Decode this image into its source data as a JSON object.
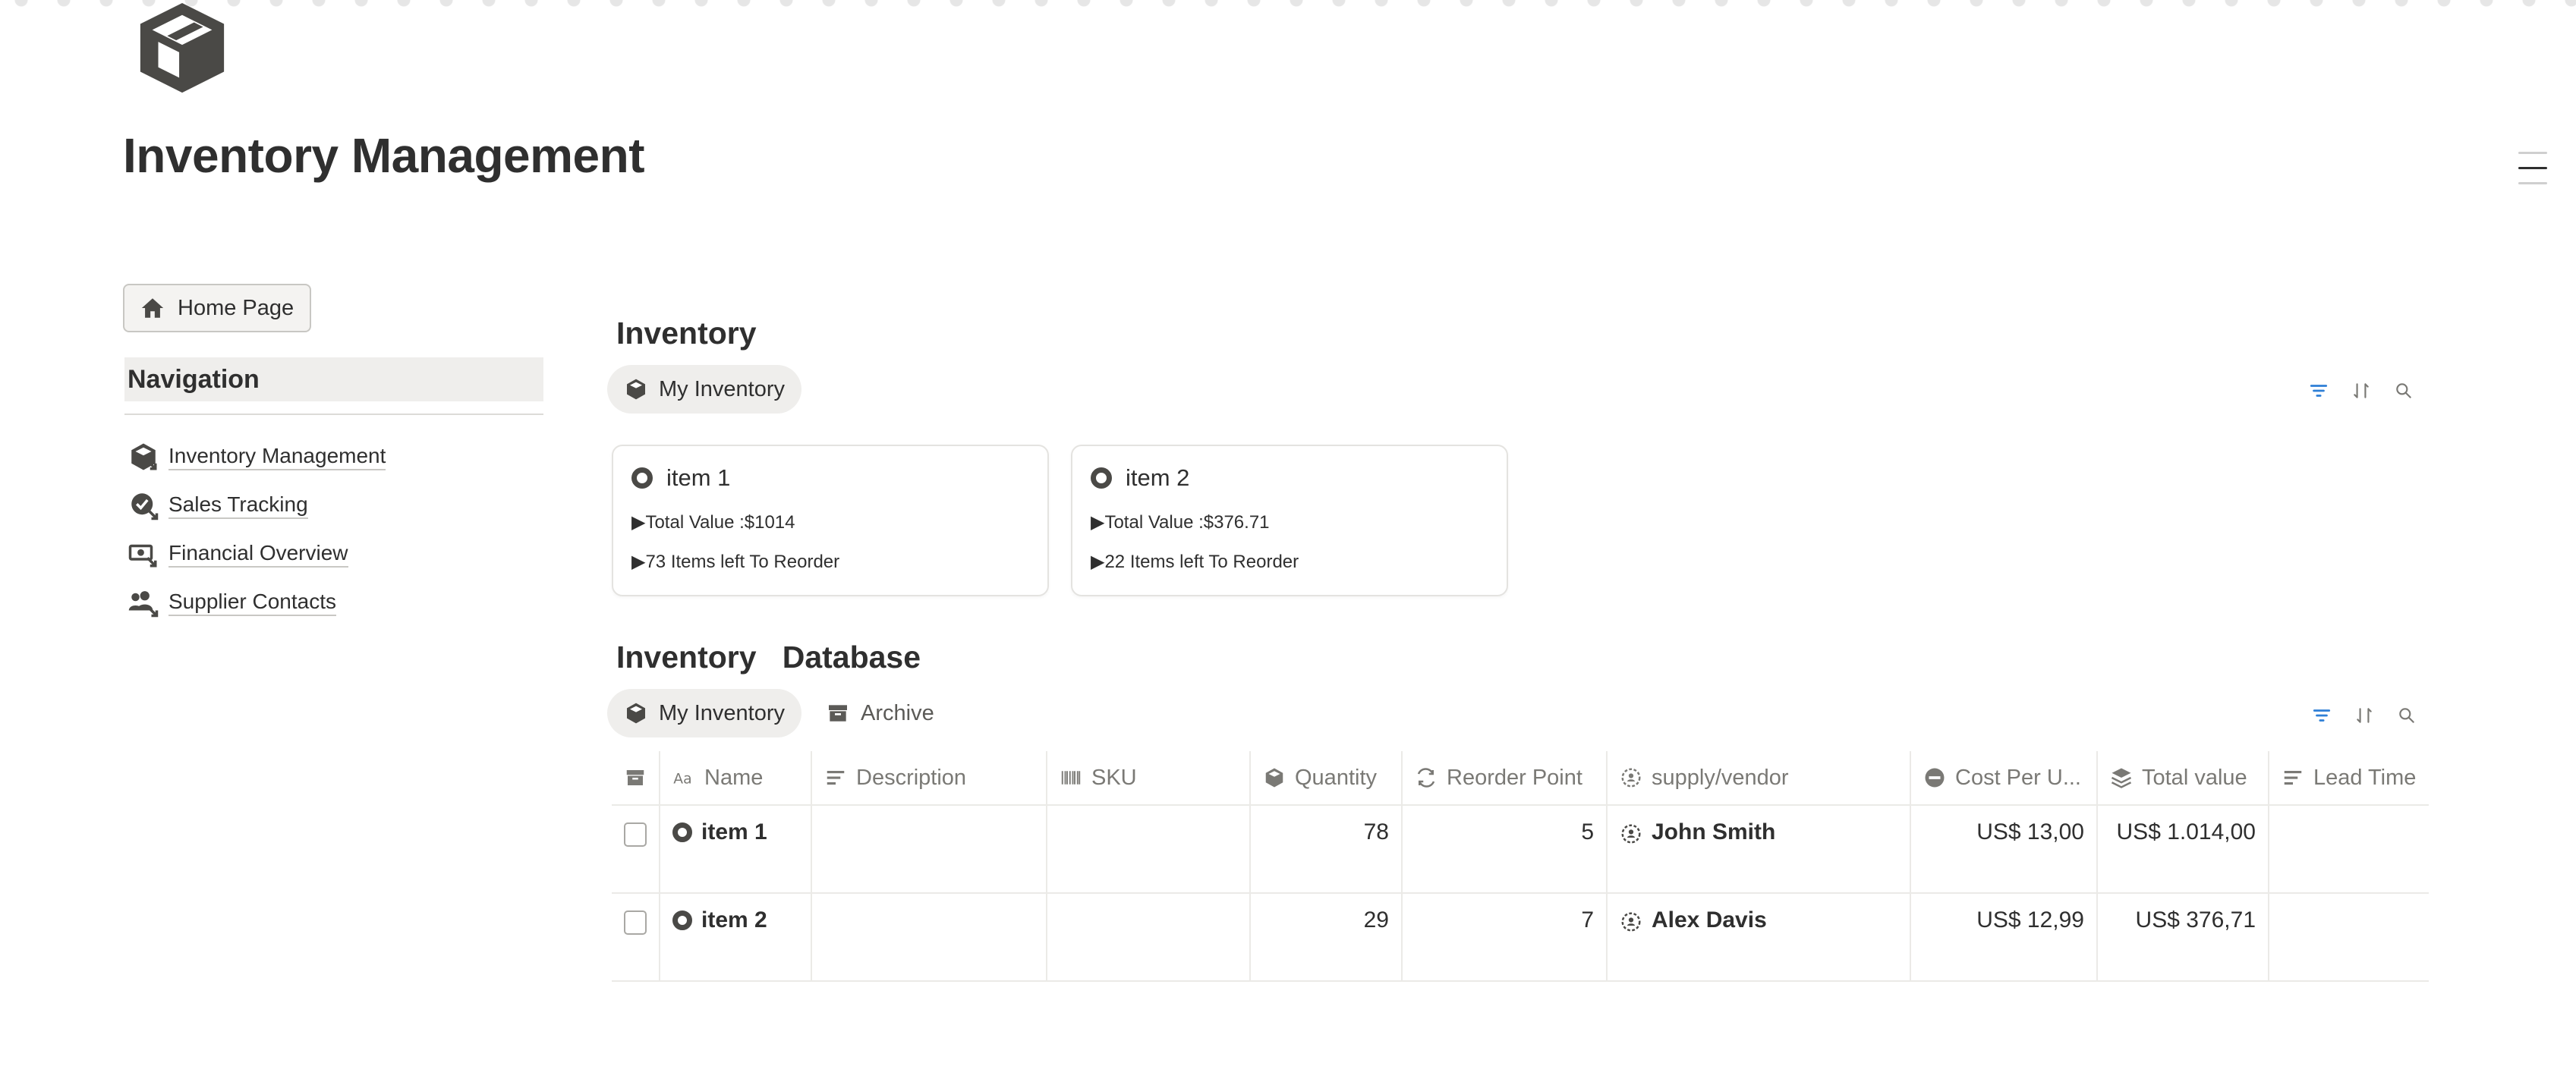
{
  "page": {
    "title": "Inventory Management"
  },
  "sidebar": {
    "home_button": "Home Page",
    "nav_heading": "Navigation",
    "items": [
      {
        "label": "Inventory Management",
        "icon": "box-link-icon"
      },
      {
        "label": "Sales Tracking",
        "icon": "badge-link-icon"
      },
      {
        "label": "Financial Overview",
        "icon": "money-link-icon"
      },
      {
        "label": "Supplier Contacts",
        "icon": "people-link-icon"
      }
    ]
  },
  "inventory_section": {
    "title": "Inventory",
    "view_tab": "My Inventory",
    "cards": [
      {
        "title": "item 1",
        "line1": "▶Total Value :$1014",
        "line2": "▶73 Items left To Reorder"
      },
      {
        "title": "item 2",
        "line1": "▶Total Value :$376.71",
        "line2": "▶22 Items left To Reorder"
      }
    ]
  },
  "database_section": {
    "title": "Inventory   Database",
    "tabs": [
      "My Inventory",
      "Archive"
    ],
    "columns": [
      "Name",
      "Description",
      "SKU",
      "Quantity",
      "Reorder Point",
      "supply/vendor",
      "Cost Per U...",
      "Total value",
      "Lead Time"
    ],
    "rows": [
      {
        "name": "item 1",
        "description": "",
        "sku": "",
        "quantity": "78",
        "reorder_point": "5",
        "vendor": "John Smith",
        "cost": "US$ 13,00",
        "total": "US$ 1.014,00",
        "lead": ""
      },
      {
        "name": "item 2",
        "description": "",
        "sku": "",
        "quantity": "29",
        "reorder_point": "7",
        "vendor": "Alex Davis",
        "cost": "US$ 12,99",
        "total": "US$ 376,71",
        "lead": ""
      }
    ]
  },
  "colors": {
    "accent_filter": "#2e7fd6",
    "text": "#2f2f2f",
    "muted": "#7a7975"
  }
}
